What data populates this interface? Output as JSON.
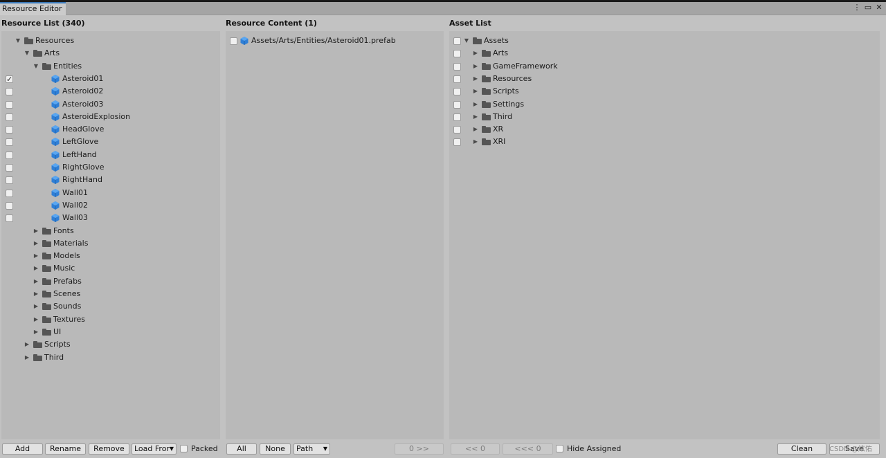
{
  "window": {
    "tab_title": "Resource Editor",
    "menu_icon": "kebab-menu-icon",
    "maximize_icon": "maximize-icon",
    "close_icon": "close-icon"
  },
  "resource_list": {
    "title": "Resource List (340)",
    "tree": [
      {
        "label": "Resources",
        "indent": 1,
        "arrow": "expanded",
        "icon": "folder"
      },
      {
        "label": "Arts",
        "indent": 2,
        "arrow": "expanded",
        "icon": "folder"
      },
      {
        "label": "Entities",
        "indent": 3,
        "arrow": "expanded",
        "icon": "folder"
      },
      {
        "label": "Asteroid01",
        "indent": 4,
        "icon": "prefab",
        "checkbox": true,
        "checked": true
      },
      {
        "label": "Asteroid02",
        "indent": 4,
        "icon": "prefab",
        "checkbox": true,
        "checked": false
      },
      {
        "label": "Asteroid03",
        "indent": 4,
        "icon": "prefab",
        "checkbox": true,
        "checked": false
      },
      {
        "label": "AsteroidExplosion",
        "indent": 4,
        "icon": "prefab",
        "checkbox": true,
        "checked": false
      },
      {
        "label": "HeadGlove",
        "indent": 4,
        "icon": "prefab",
        "checkbox": true,
        "checked": false
      },
      {
        "label": "LeftGlove",
        "indent": 4,
        "icon": "prefab",
        "checkbox": true,
        "checked": false
      },
      {
        "label": "LeftHand",
        "indent": 4,
        "icon": "prefab",
        "checkbox": true,
        "checked": false
      },
      {
        "label": "RightGlove",
        "indent": 4,
        "icon": "prefab",
        "checkbox": true,
        "checked": false
      },
      {
        "label": "RightHand",
        "indent": 4,
        "icon": "prefab",
        "checkbox": true,
        "checked": false
      },
      {
        "label": "Wall01",
        "indent": 4,
        "icon": "prefab",
        "checkbox": true,
        "checked": false
      },
      {
        "label": "Wall02",
        "indent": 4,
        "icon": "prefab",
        "checkbox": true,
        "checked": false
      },
      {
        "label": "Wall03",
        "indent": 4,
        "icon": "prefab",
        "checkbox": true,
        "checked": false
      },
      {
        "label": "Fonts",
        "indent": 3,
        "arrow": "collapsed",
        "icon": "folder"
      },
      {
        "label": "Materials",
        "indent": 3,
        "arrow": "collapsed",
        "icon": "folder"
      },
      {
        "label": "Models",
        "indent": 3,
        "arrow": "collapsed",
        "icon": "folder"
      },
      {
        "label": "Music",
        "indent": 3,
        "arrow": "collapsed",
        "icon": "folder"
      },
      {
        "label": "Prefabs",
        "indent": 3,
        "arrow": "collapsed",
        "icon": "folder"
      },
      {
        "label": "Scenes",
        "indent": 3,
        "arrow": "collapsed",
        "icon": "folder"
      },
      {
        "label": "Sounds",
        "indent": 3,
        "arrow": "collapsed",
        "icon": "folder"
      },
      {
        "label": "Textures",
        "indent": 3,
        "arrow": "collapsed",
        "icon": "folder"
      },
      {
        "label": "UI",
        "indent": 3,
        "arrow": "collapsed",
        "icon": "folder"
      },
      {
        "label": "Scripts",
        "indent": 2,
        "arrow": "collapsed",
        "icon": "folder"
      },
      {
        "label": "Third",
        "indent": 2,
        "arrow": "collapsed",
        "icon": "folder"
      }
    ],
    "buttons": {
      "add": "Add",
      "rename": "Rename",
      "remove": "Remove",
      "load_from": "Load Fror",
      "packed": "Packed"
    }
  },
  "resource_content": {
    "title": "Resource Content (1)",
    "items": [
      {
        "label": "Assets/Arts/Entities/Asteroid01.prefab",
        "icon": "prefab",
        "checked": false
      }
    ],
    "buttons": {
      "all": "All",
      "none": "None",
      "sort": "Path",
      "move_right": "0 >>"
    }
  },
  "asset_list": {
    "title": "Asset List",
    "tree": [
      {
        "label": "Assets",
        "indent": 0,
        "arrow": "expanded",
        "icon": "folder"
      },
      {
        "label": "Arts",
        "indent": 1,
        "arrow": "collapsed",
        "icon": "folder"
      },
      {
        "label": "GameFramework",
        "indent": 1,
        "arrow": "collapsed",
        "icon": "folder"
      },
      {
        "label": "Resources",
        "indent": 1,
        "arrow": "collapsed",
        "icon": "folder"
      },
      {
        "label": "Scripts",
        "indent": 1,
        "arrow": "collapsed",
        "icon": "folder"
      },
      {
        "label": "Settings",
        "indent": 1,
        "arrow": "collapsed",
        "icon": "folder"
      },
      {
        "label": "Third",
        "indent": 1,
        "arrow": "collapsed",
        "icon": "folder"
      },
      {
        "label": "XR",
        "indent": 1,
        "arrow": "collapsed",
        "icon": "folder"
      },
      {
        "label": "XRI",
        "indent": 1,
        "arrow": "collapsed",
        "icon": "folder"
      }
    ],
    "buttons": {
      "move_left": "<< 0",
      "move_all_left": "<<< 0",
      "hide_assigned": "Hide Assigned",
      "clean": "Clean",
      "save": "Save"
    }
  },
  "watermark": "CSDN @炫佑",
  "colors": {
    "prefab_blue": "#2f7fd6",
    "folder_gray": "#555555",
    "tab_accent": "#3a79bb"
  }
}
